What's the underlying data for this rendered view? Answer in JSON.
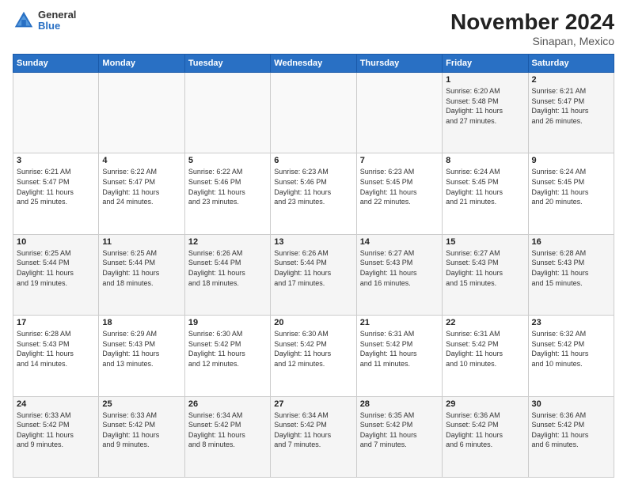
{
  "logo": {
    "line1": "General",
    "line2": "Blue"
  },
  "header": {
    "title": "November 2024",
    "subtitle": "Sinapan, Mexico"
  },
  "weekdays": [
    "Sunday",
    "Monday",
    "Tuesday",
    "Wednesday",
    "Thursday",
    "Friday",
    "Saturday"
  ],
  "weeks": [
    [
      {
        "day": "",
        "info": ""
      },
      {
        "day": "",
        "info": ""
      },
      {
        "day": "",
        "info": ""
      },
      {
        "day": "",
        "info": ""
      },
      {
        "day": "",
        "info": ""
      },
      {
        "day": "1",
        "info": "Sunrise: 6:20 AM\nSunset: 5:48 PM\nDaylight: 11 hours\nand 27 minutes."
      },
      {
        "day": "2",
        "info": "Sunrise: 6:21 AM\nSunset: 5:47 PM\nDaylight: 11 hours\nand 26 minutes."
      }
    ],
    [
      {
        "day": "3",
        "info": "Sunrise: 6:21 AM\nSunset: 5:47 PM\nDaylight: 11 hours\nand 25 minutes."
      },
      {
        "day": "4",
        "info": "Sunrise: 6:22 AM\nSunset: 5:47 PM\nDaylight: 11 hours\nand 24 minutes."
      },
      {
        "day": "5",
        "info": "Sunrise: 6:22 AM\nSunset: 5:46 PM\nDaylight: 11 hours\nand 23 minutes."
      },
      {
        "day": "6",
        "info": "Sunrise: 6:23 AM\nSunset: 5:46 PM\nDaylight: 11 hours\nand 23 minutes."
      },
      {
        "day": "7",
        "info": "Sunrise: 6:23 AM\nSunset: 5:45 PM\nDaylight: 11 hours\nand 22 minutes."
      },
      {
        "day": "8",
        "info": "Sunrise: 6:24 AM\nSunset: 5:45 PM\nDaylight: 11 hours\nand 21 minutes."
      },
      {
        "day": "9",
        "info": "Sunrise: 6:24 AM\nSunset: 5:45 PM\nDaylight: 11 hours\nand 20 minutes."
      }
    ],
    [
      {
        "day": "10",
        "info": "Sunrise: 6:25 AM\nSunset: 5:44 PM\nDaylight: 11 hours\nand 19 minutes."
      },
      {
        "day": "11",
        "info": "Sunrise: 6:25 AM\nSunset: 5:44 PM\nDaylight: 11 hours\nand 18 minutes."
      },
      {
        "day": "12",
        "info": "Sunrise: 6:26 AM\nSunset: 5:44 PM\nDaylight: 11 hours\nand 18 minutes."
      },
      {
        "day": "13",
        "info": "Sunrise: 6:26 AM\nSunset: 5:44 PM\nDaylight: 11 hours\nand 17 minutes."
      },
      {
        "day": "14",
        "info": "Sunrise: 6:27 AM\nSunset: 5:43 PM\nDaylight: 11 hours\nand 16 minutes."
      },
      {
        "day": "15",
        "info": "Sunrise: 6:27 AM\nSunset: 5:43 PM\nDaylight: 11 hours\nand 15 minutes."
      },
      {
        "day": "16",
        "info": "Sunrise: 6:28 AM\nSunset: 5:43 PM\nDaylight: 11 hours\nand 15 minutes."
      }
    ],
    [
      {
        "day": "17",
        "info": "Sunrise: 6:28 AM\nSunset: 5:43 PM\nDaylight: 11 hours\nand 14 minutes."
      },
      {
        "day": "18",
        "info": "Sunrise: 6:29 AM\nSunset: 5:43 PM\nDaylight: 11 hours\nand 13 minutes."
      },
      {
        "day": "19",
        "info": "Sunrise: 6:30 AM\nSunset: 5:42 PM\nDaylight: 11 hours\nand 12 minutes."
      },
      {
        "day": "20",
        "info": "Sunrise: 6:30 AM\nSunset: 5:42 PM\nDaylight: 11 hours\nand 12 minutes."
      },
      {
        "day": "21",
        "info": "Sunrise: 6:31 AM\nSunset: 5:42 PM\nDaylight: 11 hours\nand 11 minutes."
      },
      {
        "day": "22",
        "info": "Sunrise: 6:31 AM\nSunset: 5:42 PM\nDaylight: 11 hours\nand 10 minutes."
      },
      {
        "day": "23",
        "info": "Sunrise: 6:32 AM\nSunset: 5:42 PM\nDaylight: 11 hours\nand 10 minutes."
      }
    ],
    [
      {
        "day": "24",
        "info": "Sunrise: 6:33 AM\nSunset: 5:42 PM\nDaylight: 11 hours\nand 9 minutes."
      },
      {
        "day": "25",
        "info": "Sunrise: 6:33 AM\nSunset: 5:42 PM\nDaylight: 11 hours\nand 9 minutes."
      },
      {
        "day": "26",
        "info": "Sunrise: 6:34 AM\nSunset: 5:42 PM\nDaylight: 11 hours\nand 8 minutes."
      },
      {
        "day": "27",
        "info": "Sunrise: 6:34 AM\nSunset: 5:42 PM\nDaylight: 11 hours\nand 7 minutes."
      },
      {
        "day": "28",
        "info": "Sunrise: 6:35 AM\nSunset: 5:42 PM\nDaylight: 11 hours\nand 7 minutes."
      },
      {
        "day": "29",
        "info": "Sunrise: 6:36 AM\nSunset: 5:42 PM\nDaylight: 11 hours\nand 6 minutes."
      },
      {
        "day": "30",
        "info": "Sunrise: 6:36 AM\nSunset: 5:42 PM\nDaylight: 11 hours\nand 6 minutes."
      }
    ]
  ]
}
